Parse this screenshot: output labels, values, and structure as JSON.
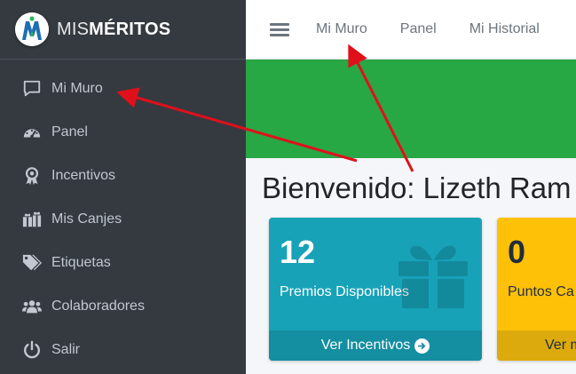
{
  "brand": {
    "light": "MIS",
    "bold": "MÉRITOS",
    "logo_icon": "mismeritos-logo"
  },
  "sidebar": {
    "items": [
      {
        "label": "Mi Muro",
        "icon": "comment-icon"
      },
      {
        "label": "Panel",
        "icon": "tachometer-icon"
      },
      {
        "label": "Incentivos",
        "icon": "award-icon"
      },
      {
        "label": "Mis Canjes",
        "icon": "gifts-icon"
      },
      {
        "label": "Etiquetas",
        "icon": "tags-icon"
      },
      {
        "label": "Colaboradores",
        "icon": "users-icon"
      },
      {
        "label": "Salir",
        "icon": "power-icon"
      }
    ]
  },
  "topnav": {
    "menu_icon": "hamburger-icon",
    "links": [
      "Mi Muro",
      "Panel",
      "Mi Historial"
    ]
  },
  "main": {
    "welcome": "Bienvenido: Lizeth Ram",
    "boxes": [
      {
        "value": "12",
        "label": "Premios Disponibles",
        "footer": "Ver Incentivos",
        "icon": "gift-icon"
      },
      {
        "value": "0",
        "label": "Puntos Ca",
        "footer": "Ver m"
      }
    ]
  },
  "colors": {
    "sidebar_bg": "#343a40",
    "banner": "#28a745",
    "info": "#17a2b8",
    "warning": "#ffc107",
    "annotation_arrow": "#e0101a"
  }
}
